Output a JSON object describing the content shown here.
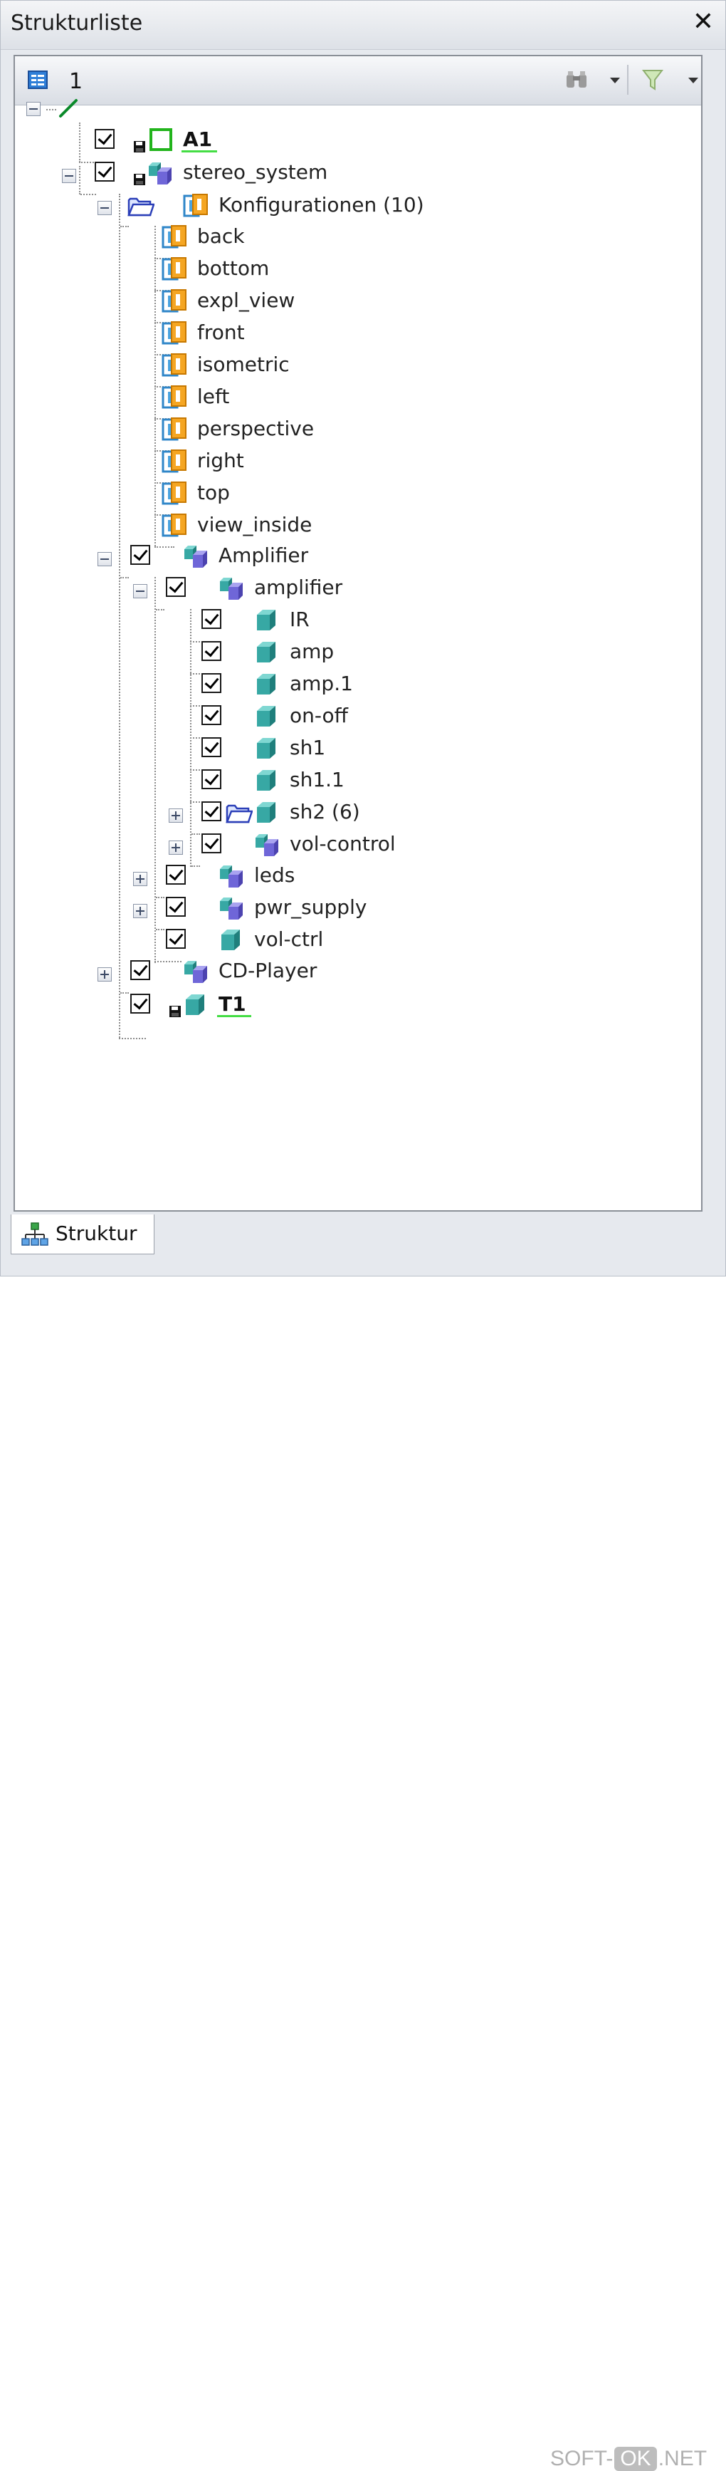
{
  "panel": {
    "title": "Strukturliste"
  },
  "toolbar": {
    "number": "1"
  },
  "tree": {
    "root": {
      "icon": "sketch-line-icon"
    },
    "a1": {
      "label": "A1"
    },
    "stereo": {
      "label": "stereo_system"
    },
    "configs_folder": {
      "label": "Konfigurationen (10)"
    },
    "configs": [
      "back",
      "bottom",
      "expl_view",
      "front",
      "isometric",
      "left",
      "perspective",
      "right",
      "top",
      "view_inside"
    ],
    "amplifier_group": {
      "label": "Amplifier"
    },
    "amplifier_sub": {
      "label": "amplifier"
    },
    "amp_parts": [
      "IR",
      "amp",
      "amp.1",
      "on-off",
      "sh1",
      "sh1.1",
      "sh2 (6)",
      "vol-control"
    ],
    "other_parts": [
      "leds",
      "pwr_supply",
      "vol-ctrl"
    ],
    "cd_player": {
      "label": "CD-Player"
    },
    "t1": {
      "label": "T1"
    }
  },
  "tabs": [
    {
      "label": "Struktur"
    }
  ],
  "watermark": {
    "prefix": "SOFT-",
    "box": "OK",
    "suffix": ".NET"
  },
  "colors": {
    "accent_underline": "#44dd44",
    "part_teal": "#3fb5b0",
    "assembly_blue": "#7a72e0",
    "config_orange": "#f5a623",
    "config_blue": "#4aa3df"
  }
}
